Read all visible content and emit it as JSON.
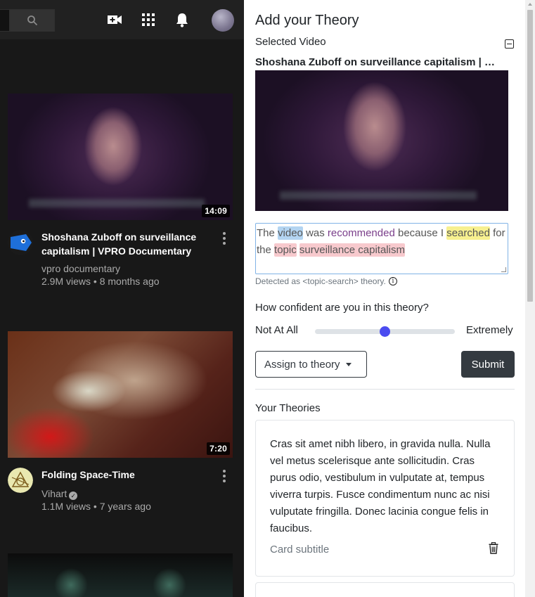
{
  "youtube": {
    "videos": [
      {
        "title": "Shoshana Zuboff on surveillance capitalism | VPRO Documentary",
        "channel": "vpro documentary",
        "meta": "2.9M views • 8 months ago",
        "duration": "14:09",
        "verified": false
      },
      {
        "title": "Folding Space-Time",
        "channel": "Vihart",
        "meta": "1.1M views • 7 years ago",
        "duration": "7:20",
        "verified": true
      }
    ]
  },
  "extension": {
    "title": "Add your Theory",
    "selected_label": "Selected Video",
    "selected_title": "Shoshana Zuboff on surveillance capitalism | VPRO Documentary",
    "theory_text": {
      "w1": "The",
      "w2": "video",
      "w3": "was",
      "w4": "recommended",
      "w5": "because I",
      "w6": "searched",
      "w7": "for the",
      "w8": "topic",
      "w9": "surveillance capitalism"
    },
    "detected": "Detected as <topic-search> theory.",
    "confidence_question": "How confident are you in this theory?",
    "confidence_low": "Not At All",
    "confidence_high": "Extremely",
    "confidence_value": 0.5,
    "assign_label": "Assign to theory",
    "submit_label": "Submit",
    "your_theories_label": "Your Theories",
    "cards": [
      {
        "text": "Cras sit amet nibh libero, in gravida nulla. Nulla vel metus scelerisque ante sollicitudin. Cras purus odio, vestibulum in vulputate at, tempus viverra turpis. Fusce condimentum nunc ac nisi vulputate fringilla. Donec lacinia congue felis in faucibus.",
        "subtitle": "Card subtitle"
      }
    ]
  },
  "colors": {
    "accent": "#4b4cf0",
    "highlight_blue": "#b3d4f1",
    "highlight_yellow": "#f7f08f",
    "highlight_red": "#f7c9cd"
  }
}
